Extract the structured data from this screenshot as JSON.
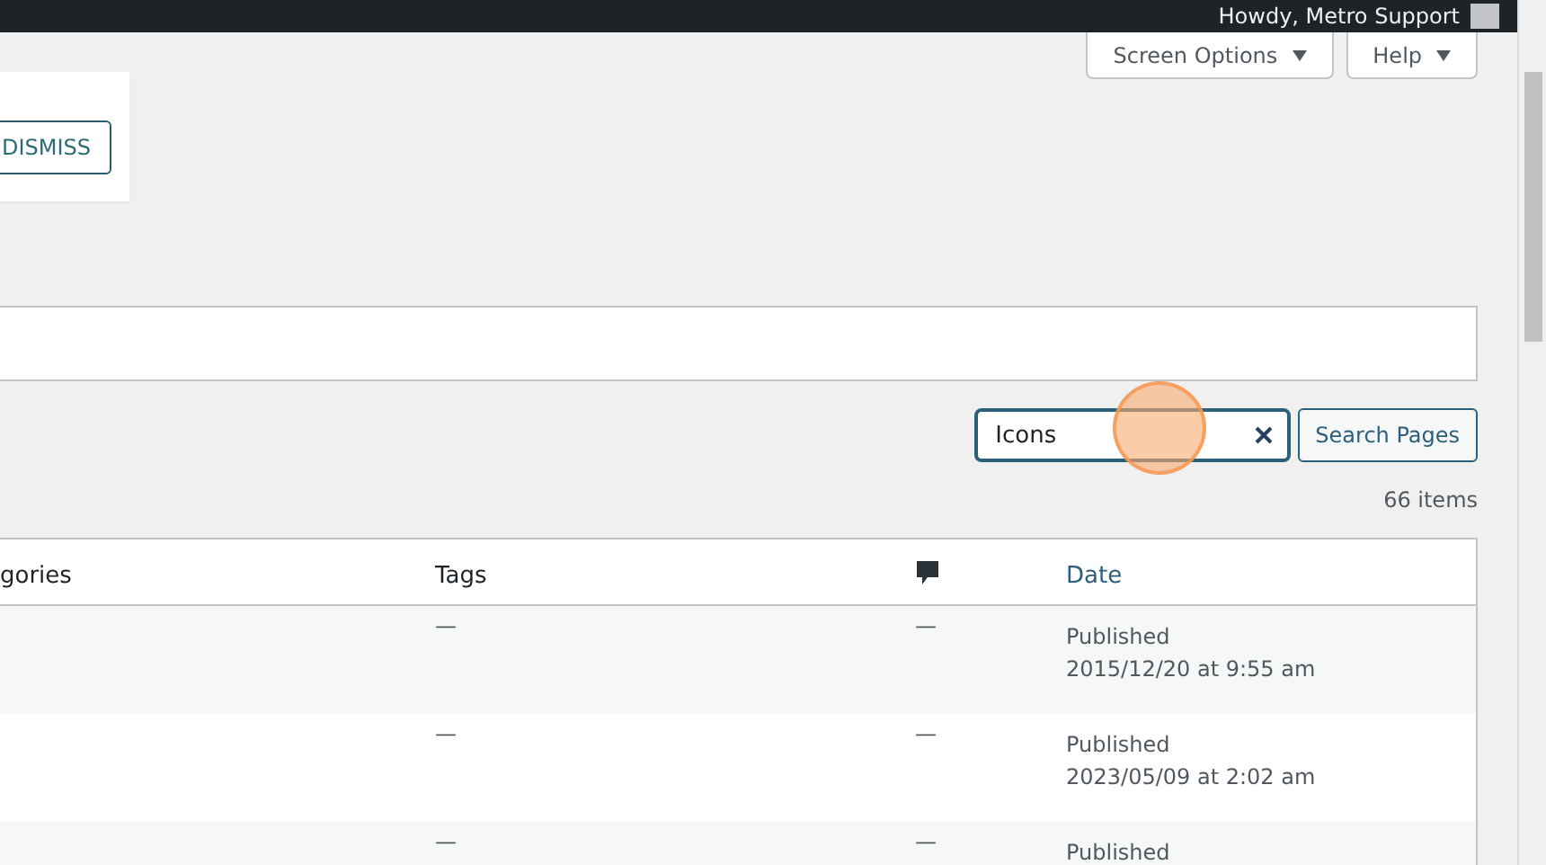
{
  "admin_bar": {
    "greeting": "Howdy, Metro Support"
  },
  "screen_meta": {
    "buttons": [
      "Screen Options",
      "Help"
    ]
  },
  "notice": {
    "button": "DISMISS"
  },
  "search": {
    "value": "Icons",
    "button": "Search Pages"
  },
  "item_count": "66 items",
  "table": {
    "columns": [
      {
        "kind": "text",
        "label": "gories"
      },
      {
        "kind": "text",
        "label": "Tags"
      },
      {
        "kind": "comments"
      },
      {
        "kind": "link",
        "label": "Date"
      }
    ],
    "rows": [
      {
        "cells": [
          "",
          "—",
          "—"
        ],
        "status": "Published",
        "date": "2015/12/20 at 9:55 am"
      },
      {
        "cells": [
          "",
          "—",
          "—"
        ],
        "status": "Published",
        "date": "2023/05/09 at 2:02 am"
      },
      {
        "cells": [
          "",
          "—",
          "—"
        ],
        "status": "Published",
        "date": ""
      }
    ]
  }
}
